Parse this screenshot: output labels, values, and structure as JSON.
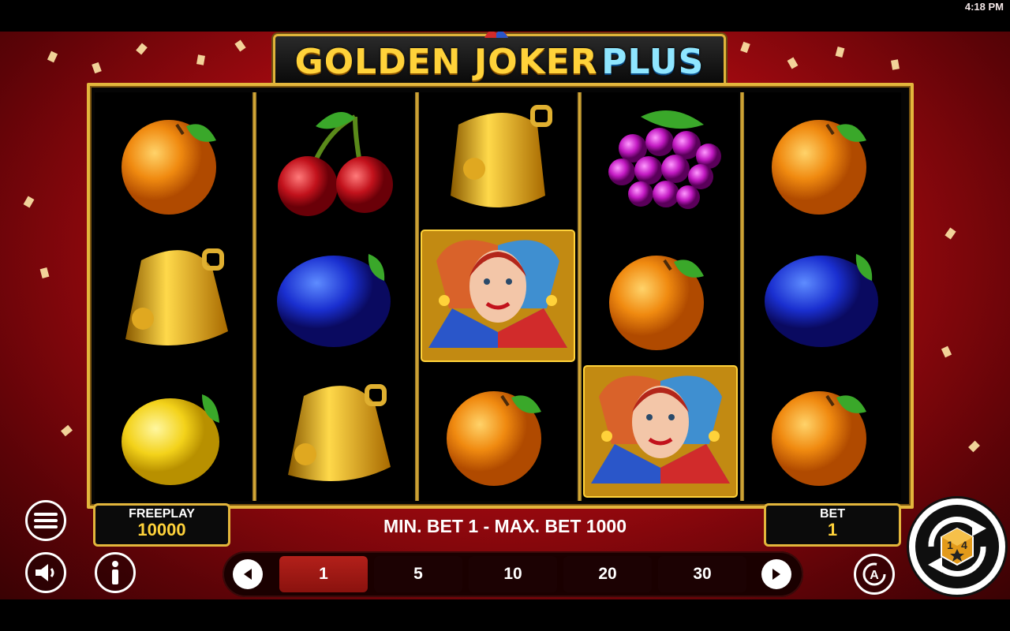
{
  "status": {
    "time": "4:18 PM"
  },
  "game": {
    "title_gold": "GOLDEN JOKER",
    "title_blue": "PLUS"
  },
  "reels": [
    [
      "orange",
      "bell",
      "lemon"
    ],
    [
      "cherry",
      "plum",
      "bell"
    ],
    [
      "bell",
      "joker",
      "orange"
    ],
    [
      "grapes",
      "orange",
      "joker"
    ],
    [
      "orange",
      "plum",
      "orange"
    ]
  ],
  "balance": {
    "label": "FREEPLAY",
    "value": "10000"
  },
  "bet": {
    "label": "BET",
    "value": "1"
  },
  "limits": {
    "text": "MIN. BET 1 - MAX. BET 1000"
  },
  "bet_options": {
    "values": [
      "1",
      "5",
      "10",
      "20",
      "30"
    ],
    "selected": "1"
  },
  "spin_badge": {
    "text": "1",
    "text2": "4"
  },
  "icons": {
    "menu": "hamburger-menu-icon",
    "sound": "speaker-icon",
    "info": "info-icon",
    "autoplay": "autoplay-a-icon",
    "prev": "left-arrow-icon",
    "next": "right-arrow-icon",
    "spin": "spin-icon"
  },
  "colors": {
    "frame_gold": "#e3b63c",
    "background_red": "#a40a10",
    "value_yellow": "#ffd23a",
    "selected_chip": "#b3201a"
  }
}
